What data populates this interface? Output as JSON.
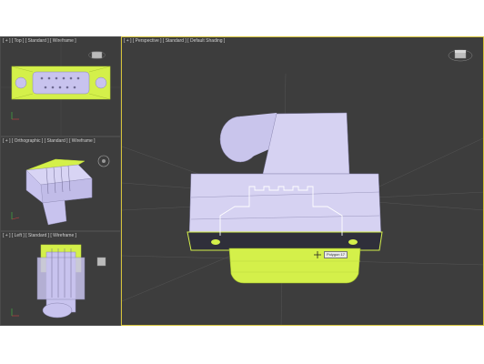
{
  "viewports": {
    "top": {
      "label": "[ + ] [ Top ] [ Standard ] [ Wireframe ]"
    },
    "ortho": {
      "label": "[ + ] [ Orthographic ] [ Standard ] [ Wireframe ]"
    },
    "left": {
      "label": "[ + ] [ Left ] [ Standard ] [ Wireframe ]"
    },
    "perspective": {
      "label": "[ + ] [ Perspective ] [ Standard ] [ Default Shading ]"
    }
  },
  "cursor_tooltip": "Polygon 17",
  "colors": {
    "selection_wire": "#d4f04a",
    "model_body": "#d6d2f2",
    "model_shaded": "#c9c5ec",
    "viewport_bg": "#3d3d3d",
    "active_border": "#d4c23a"
  },
  "icons": [
    "viewcube-icon",
    "axis-tripod-icon",
    "steering-wheel-icon"
  ]
}
